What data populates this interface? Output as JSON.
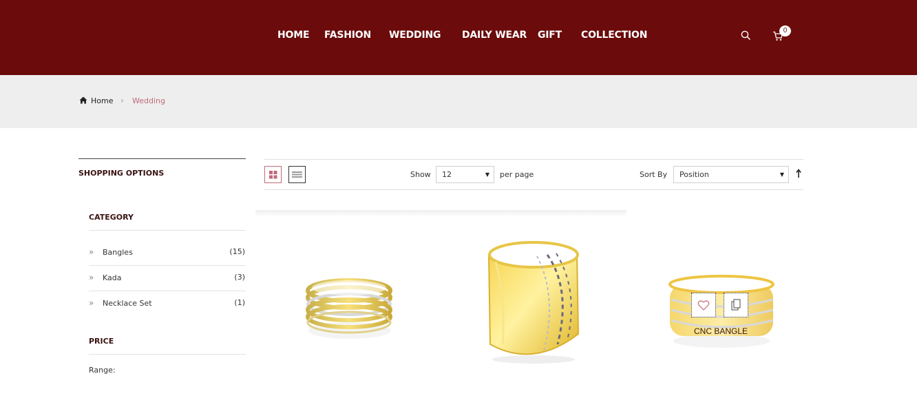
{
  "header": {
    "nav": [
      "HOME",
      "FASHION",
      "WEDDING",
      "DAILY WEAR",
      "GIFT",
      "COLLECTION"
    ],
    "cart_count": "0"
  },
  "breadcrumb": {
    "home": "Home",
    "current": "Wedding"
  },
  "sidebar": {
    "title": "SHOPPING OPTIONS",
    "category_title": "CATEGORY",
    "categories": [
      {
        "label": "Bangles",
        "count": "(15)"
      },
      {
        "label": "Kada",
        "count": "(3)"
      },
      {
        "label": "Necklace Set",
        "count": "(1)"
      }
    ],
    "price_title": "PRICE",
    "range_label": "Range:"
  },
  "toolbar": {
    "show_label": "Show",
    "limit_value": "12",
    "per_page_label": "per page",
    "sort_label": "Sort By",
    "sort_value": "Position"
  },
  "products": [
    {
      "name": ""
    },
    {
      "name": ""
    },
    {
      "name": "CNC BANGLE"
    }
  ],
  "colors": {
    "header_bg": "#6b0b0b",
    "accent": "#c26a7a",
    "gold": "#f2cf3d"
  }
}
